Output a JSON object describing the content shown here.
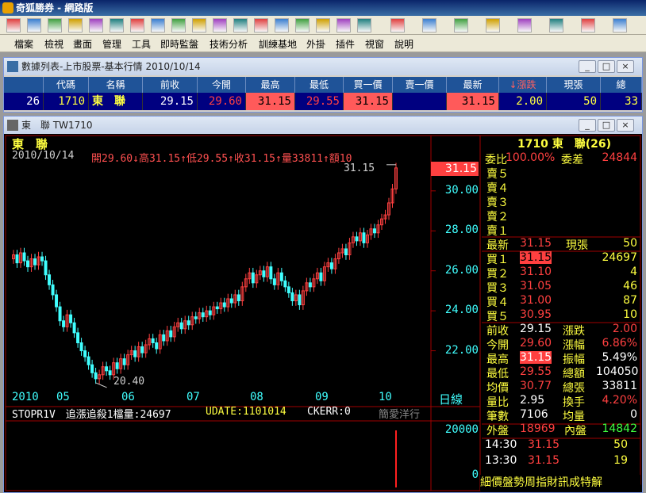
{
  "app": {
    "title": "奇狐勝券 - 網路版"
  },
  "menu": [
    "檔案",
    "檢視",
    "畫面",
    "管理",
    "工具",
    "即時監盤",
    "技術分析",
    "訓練基地",
    "外掛",
    "插件",
    "視窗",
    "說明"
  ],
  "toolbar_icons": [
    "open-icon",
    "chart-icon",
    "refresh-icon",
    "forward-icon",
    "back-icon",
    "quote-icon",
    "alert-icon",
    "news-icon",
    "report-icon",
    "calendar-icon",
    "table-icon",
    "search-icon",
    "tools-icon",
    "candle-icon",
    "grid-icon",
    "window-icon",
    "layout-icon",
    "image-icon",
    "cursor-icon",
    "line-icon",
    "hline-icon",
    "fan-icon",
    "parallel-icon",
    "cross-icon",
    "circle-icon",
    "rect-icon"
  ],
  "quote_list": {
    "title": "數據列表-上市股票-基本行情 2010/10/14",
    "headers": [
      "代碼",
      "名稱",
      "前收",
      "今開",
      "最高",
      "最低",
      "買一價",
      "賣一價",
      "最新",
      "↓漲跌",
      "現張",
      "總"
    ],
    "row": [
      "26",
      "1710",
      "東　聯",
      "29.15",
      "29.60",
      "31.15",
      "29.55",
      "31.15",
      "",
      "31.15",
      "2.00",
      "50",
      "33"
    ]
  },
  "chart_window": {
    "title": "東　聯 TW1710",
    "stock_name": "東　聯",
    "info_line": "2010/10/14",
    "info_ohlc": "開29.60↓高31.15↑低29.55↑收31.15↑量33811↑額10",
    "last_price_label": "31.15",
    "min_label": "20.40",
    "y_ticks": [
      "30.00",
      "28.00",
      "26.00",
      "24.00",
      "22.00"
    ],
    "months": [
      "2010",
      "05",
      "06",
      "07",
      "08",
      "09",
      "10"
    ],
    "period": "日線",
    "status": "STOPR1V　追漲追殺1檔量:24697",
    "udate": "UDATE:1101014",
    "ckerr": "CKERR:0",
    "ticker_scroll": "簡愛洋行",
    "vol_ticks": [
      "20000",
      "0"
    ],
    "bottom_tabs": "細價盤勢周指財訊成特解"
  },
  "quote_panel": {
    "header": "1710 東　聯(26)",
    "ratio_label": "委比",
    "ratio_value": "100.00%",
    "diff_label": "委差",
    "diff_value": "24844",
    "sells": [
      "賣５",
      "賣４",
      "賣３",
      "賣２",
      "賣１"
    ],
    "last_label": "最新",
    "last_value": "31.15",
    "vol_label": "現張",
    "vol_value": "50",
    "buys": [
      {
        "label": "買１",
        "price": "31.15",
        "qty": "24697"
      },
      {
        "label": "買２",
        "price": "31.10",
        "qty": "4"
      },
      {
        "label": "買３",
        "price": "31.05",
        "qty": "46"
      },
      {
        "label": "買４",
        "price": "31.00",
        "qty": "87"
      },
      {
        "label": "買５",
        "price": "30.95",
        "qty": "10"
      }
    ],
    "stats": [
      {
        "l1": "前收",
        "v1": "29.15",
        "l2": "漲跌",
        "v2": "2.00"
      },
      {
        "l1": "今開",
        "v1": "29.60",
        "l2": "漲幅",
        "v2": "6.86%"
      },
      {
        "l1": "最高",
        "v1": "31.15",
        "l2": "振幅",
        "v2": "5.49%"
      },
      {
        "l1": "最低",
        "v1": "29.55",
        "l2": "總額",
        "v2": "104050"
      },
      {
        "l1": "均價",
        "v1": "30.77",
        "l2": "總張",
        "v2": "33811"
      },
      {
        "l1": "量比",
        "v1": "2.95",
        "l2": "換手",
        "v2": "4.20%"
      },
      {
        "l1": "筆數",
        "v1": "7106",
        "l2": "均量",
        "v2": "0"
      }
    ],
    "outer_label": "外盤",
    "outer_value": "18969",
    "inner_label": "內盤",
    "inner_value": "14842",
    "ticks": [
      {
        "time": "14:30",
        "price": "31.15",
        "qty": "50"
      },
      {
        "time": "13:30",
        "price": "31.15",
        "qty": "19"
      }
    ]
  },
  "chart_data": {
    "type": "candlestick",
    "ylim": [
      20,
      31.5
    ],
    "closes": [
      26.8,
      26.4,
      26.9,
      26.5,
      26.2,
      26.6,
      26.3,
      26.7,
      26.5,
      25.8,
      25.3,
      24.8,
      24.2,
      23.5,
      23.2,
      23.8,
      23.4,
      22.9,
      22.4,
      22.0,
      21.7,
      21.3,
      20.9,
      20.6,
      20.8,
      21.2,
      21.0,
      20.8,
      21.4,
      21.1,
      21.6,
      21.3,
      21.8,
      22.0,
      21.7,
      22.2,
      21.9,
      22.3,
      22.6,
      22.4,
      22.1,
      22.8,
      22.5,
      23.0,
      22.7,
      23.2,
      23.4,
      23.1,
      23.5,
      23.3,
      23.7,
      23.6,
      23.9,
      23.7,
      24.0,
      23.8,
      24.2,
      24.1,
      24.4,
      24.2,
      24.6,
      24.4,
      24.8,
      24.5,
      25.2,
      25.6,
      25.9,
      25.4,
      25.8,
      26.0,
      25.7,
      26.2,
      25.6,
      25.3,
      25.9,
      25.5,
      25.2,
      24.9,
      24.5,
      24.8,
      24.3,
      25.0,
      25.4,
      25.2,
      25.6,
      25.9,
      25.5,
      26.2,
      26.4,
      26.1,
      26.6,
      26.9,
      27.1,
      26.8,
      27.4,
      27.7,
      27.5,
      27.9,
      27.4,
      27.8,
      28.1,
      27.9,
      28.3,
      28.6,
      28.8,
      29.4,
      30.1,
      31.15
    ],
    "min_value": 20.4,
    "volumes": [
      0,
      0,
      0,
      0,
      0,
      0,
      0,
      0,
      0,
      0,
      0,
      0,
      0,
      0,
      0,
      0,
      0,
      0,
      0,
      0,
      0,
      0,
      0,
      0,
      0,
      0,
      0,
      0,
      0,
      0,
      0,
      0,
      0,
      0,
      0,
      0,
      0,
      0,
      0,
      0,
      0,
      0,
      0,
      0,
      0,
      0,
      0,
      0,
      0,
      0,
      0,
      0,
      0,
      0,
      0,
      0,
      0,
      0,
      0,
      0,
      0,
      0,
      0,
      0,
      0,
      0,
      0,
      0,
      0,
      0,
      0,
      0,
      0,
      0,
      0,
      0,
      0,
      0,
      0,
      0,
      0,
      0,
      0,
      0,
      0,
      0,
      0,
      0,
      0,
      0,
      0,
      0,
      0,
      0,
      0,
      0,
      0,
      0,
      0,
      0,
      0,
      0,
      0,
      0,
      0,
      0,
      0,
      33811
    ],
    "vol_max": 25000
  }
}
